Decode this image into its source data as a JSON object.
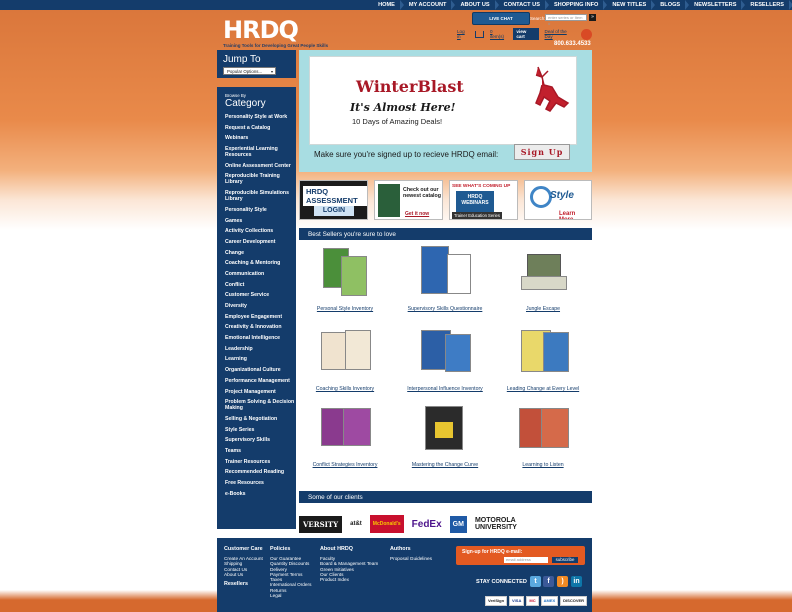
{
  "top_nav": [
    "HOME",
    "MY ACCOUNT",
    "ABOUT US",
    "CONTACT US",
    "SHOPPING INFO",
    "NEW TITLES",
    "BLOGS",
    "NEWSLETTERS",
    "RESELLERS"
  ],
  "header": {
    "logo": "HRDQ",
    "tagline": "Training Tools for Developing Great People Skills",
    "live_chat": "LIVE CHAT",
    "search_label": "Search:",
    "search_placeholder": "enter series or Item #",
    "search_go": "»",
    "login": "Log in",
    "cart_count": "0 item(s)",
    "view_cart": "view cart",
    "deal": "Deal of the Day",
    "phone": "800.633.4533"
  },
  "jump": {
    "title": "Jump To",
    "selected": "Popular Options..."
  },
  "categories": {
    "browse": "Browse By",
    "title": "Category",
    "items": [
      "Personality Style at Work",
      "Request a Catalog",
      "Webinars",
      "Experiential Learning Resources",
      "Online Assessment Center",
      "Reproducible Training Library",
      "Reproducible Simulations Library",
      "Personality Style",
      "Games",
      "Activity Collections",
      "Career Development",
      "Change",
      "Coaching & Mentoring",
      "Communication",
      "Conflict",
      "Customer Service",
      "Diversity",
      "Employee Engagement",
      "Creativity & Innovation",
      "Emotional Intelligence",
      "Leadership",
      "Learning",
      "Organizational Culture",
      "Performance Management",
      "Project Management",
      "Problem Solving & Decision Making",
      "Selling & Negotiation",
      "Style Series",
      "Supervisory Skills",
      "Teams",
      "Trainer Resources",
      "Recommended Reading",
      "Free Resources",
      "e-Books"
    ]
  },
  "hero": {
    "headline": "WinterBlast",
    "subhead": "It's Almost Here!",
    "deals": "10 Days of Amazing Deals!",
    "signup_text": "Make sure you're signed up to recieve HRDQ email:",
    "signup_button": "Sign Up"
  },
  "promos": {
    "assessment": "HRDQ ASSESSMENT",
    "assessment_button": "LOGIN",
    "catalog": "Check out our newest catalog",
    "catalog_link": "Get it now",
    "webinars_head": "SEE WHAT'S COMING UP",
    "webinars_box": "HRDQ WEBINARS",
    "webinars_foot": "Trainer Education Series",
    "style": "Style",
    "style_more": "Learn More"
  },
  "best_sellers": {
    "title": "Best Sellers you're sure to love",
    "items": [
      "Personal Style Inventory",
      "Supervisory Skills Questionnaire",
      "Jungle Escape",
      "Coaching Skills Inventory",
      "Interpersonal Influence Inventory",
      "Leading Change at Every Level",
      "Conflict Strategies Inventory",
      "Mastering the Change Curve",
      "Learning to Listen"
    ]
  },
  "clients": {
    "title": "Some of our clients",
    "logos": [
      "VERSITY",
      "at&t",
      "McDonald's",
      "FedEx",
      "GM",
      "MOTOROLA UNIVERSITY"
    ]
  },
  "footer": {
    "customer_care": {
      "title": "Customer Care",
      "links": [
        "Create An Account",
        "Shipping",
        "Contact Us",
        "About Us"
      ]
    },
    "resellers": "Resellers",
    "policies": {
      "title": "Policies",
      "links": [
        "Our Guarantee",
        "Quantity Discounts",
        "Delivery",
        "Payment Terms",
        "Taxes",
        "International Orders",
        "Returns",
        "Legal"
      ]
    },
    "about": {
      "title": "About HRDQ",
      "links": [
        "Faculty",
        "Board & Management Team",
        "Green Initiatives",
        "Our Clients",
        "Product Index"
      ]
    },
    "authors": {
      "title": "Authors",
      "links": [
        "Proposal Guidelines"
      ]
    },
    "optin_title": "Sign-up for HRDQ e-mail:",
    "optin_placeholder": "email address",
    "optin_button": "subscribe",
    "stay_connected": "STAY CONNECTED",
    "badges": [
      "VeriSign",
      "VISA",
      "MC",
      "AMEX",
      "DISCOVER"
    ]
  }
}
